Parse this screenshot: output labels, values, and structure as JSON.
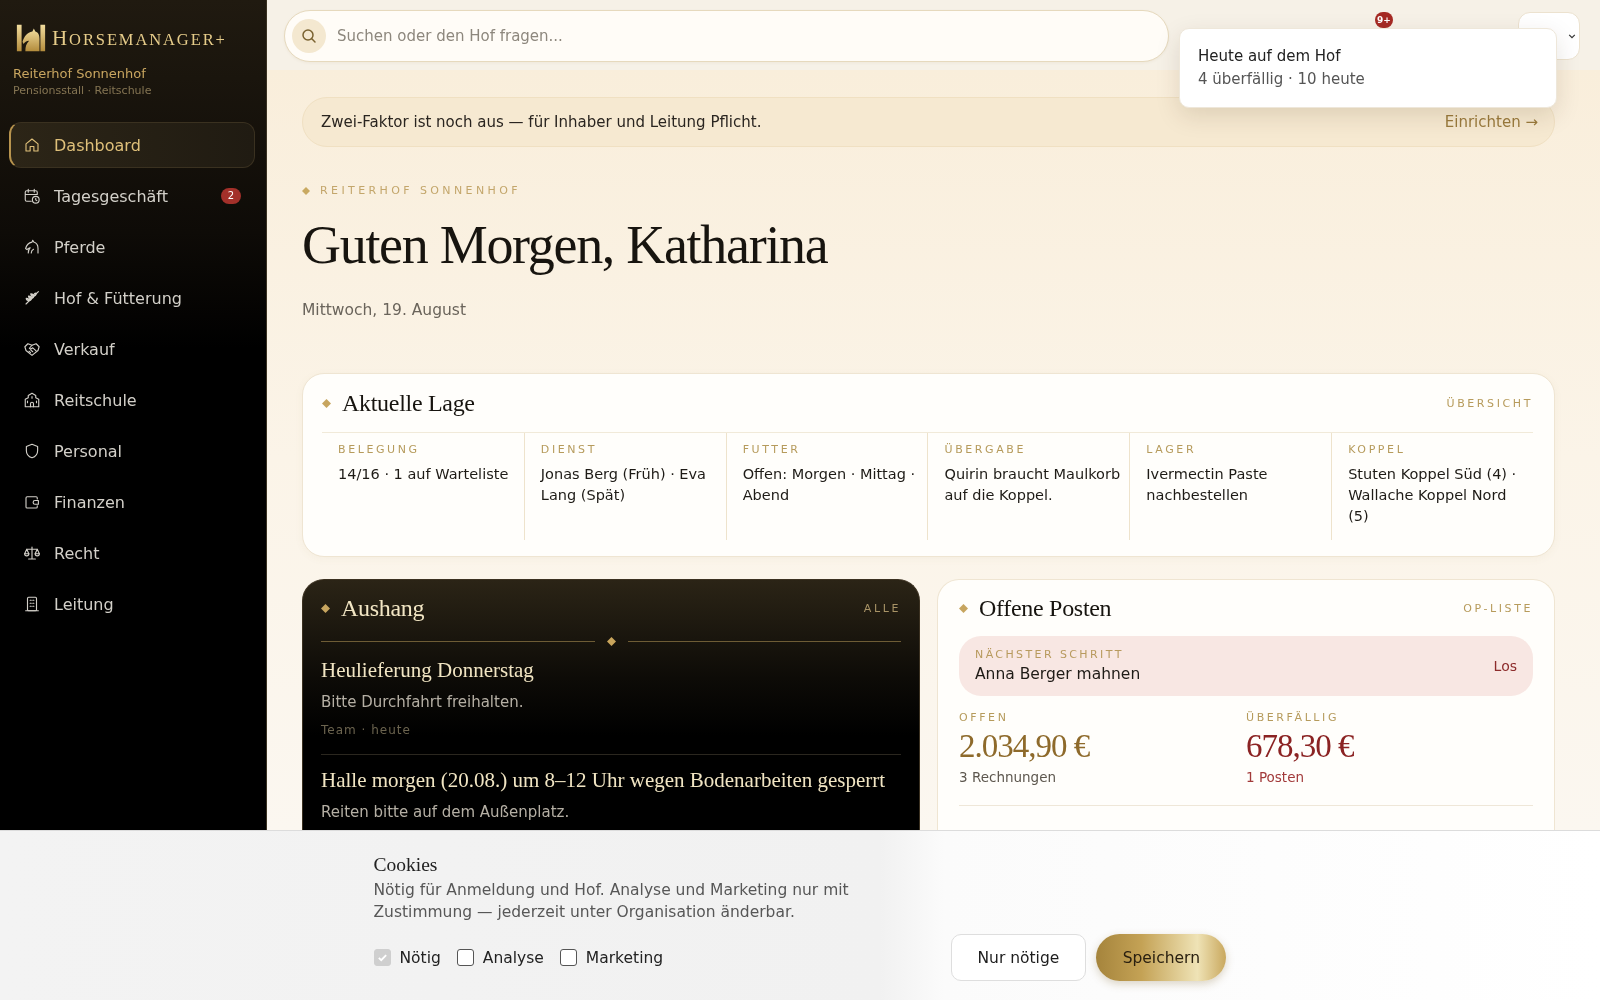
{
  "sidebar": {
    "brand": "HORSEMANAGER+",
    "farm": "Reiterhof Sonnenhof",
    "farm_type": "Pensionsstall · Reitschule",
    "items": [
      {
        "label": "Dashboard",
        "selected": true
      },
      {
        "label": "Tagesgeschäft",
        "selected": false,
        "badge": "2"
      },
      {
        "label": "Pferde",
        "selected": false
      },
      {
        "label": "Hof & Fütterung",
        "selected": false
      },
      {
        "label": "Verkauf",
        "selected": false
      },
      {
        "label": "Reitschule",
        "selected": false
      },
      {
        "label": "Personal",
        "selected": false
      },
      {
        "label": "Finanzen",
        "selected": false
      },
      {
        "label": "Recht",
        "selected": false
      },
      {
        "label": "Leitung",
        "selected": false
      }
    ]
  },
  "topbar": {
    "search": {
      "placeholder": "Suchen oder den Hof fragen..."
    },
    "notification_badge": "9+",
    "popover": {
      "title": "Heute auf dem Hof",
      "summary": "4 überfällig · 10 heute"
    }
  },
  "security_banner": {
    "text": "Zwei-Faktor ist noch aus — für Inhaber und Leitung Pflicht.",
    "action": "Einrichten →"
  },
  "header": {
    "eyebrow": "REITERHOF SONNENHOF",
    "greeting": "Guten Morgen, Katharina",
    "date": "Mittwoch, 19. August"
  },
  "situation": {
    "title": "Aktuelle Lage",
    "link": "ÜBERSICHT",
    "columns": [
      {
        "label": "BELEGUNG",
        "value": "14/16 · 1 auf Warteliste"
      },
      {
        "label": "DIENST",
        "value": "Jonas Berg (Früh) · Eva Lang (Spät)"
      },
      {
        "label": "FUTTER",
        "value": "Offen: Morgen · Mittag · Abend"
      },
      {
        "label": "ÜBERGABE",
        "value": "Quirin braucht Maulkorb auf die Koppel."
      },
      {
        "label": "LAGER",
        "value": "Ivermectin Paste nachbestellen"
      },
      {
        "label": "KOPPEL",
        "value": "Stuten Koppel Süd (4) · Wallache Koppel Nord (5)"
      }
    ]
  },
  "notices": {
    "title": "Aushang",
    "link": "ALLE",
    "items": [
      {
        "title": "Heulieferung Donnerstag",
        "text": "Bitte Durchfahrt freihalten.",
        "meta": "Team · heute"
      },
      {
        "title": "Halle morgen (20.08.) um 8–12 Uhr wegen Bodenarbeiten gesperrt",
        "text": "Reiten bitte auf dem Außenplatz."
      }
    ]
  },
  "open_items": {
    "title": "Offene Posten",
    "link": "OP-LISTE",
    "next_step": {
      "label": "NÄCHSTER SCHRITT",
      "text": "Anna Berger mahnen",
      "action": "Los"
    },
    "stats": [
      {
        "kind": "open",
        "label": "OFFEN",
        "amount": "2.034,90 €",
        "note": "3 Rechnungen"
      },
      {
        "kind": "overdue",
        "label": "ÜBERFÄLLIG",
        "amount": "678,30 €",
        "note": "1 Posten"
      }
    ]
  },
  "cookies": {
    "title": "Cookies",
    "text": "Nötig für Anmeldung und Hof. Analyse und Marketing nur mit Zustimmung — jederzeit unter Organisation änderbar.",
    "options": [
      {
        "label": "Nötig",
        "checked": true,
        "disabled": true
      },
      {
        "label": "Analyse",
        "checked": false,
        "disabled": false
      },
      {
        "label": "Marketing",
        "checked": false,
        "disabled": false
      }
    ],
    "buttons": [
      {
        "kind": "secondary",
        "label": "Nur nötige"
      },
      {
        "kind": "primary",
        "label": "Speichern"
      }
    ]
  }
}
